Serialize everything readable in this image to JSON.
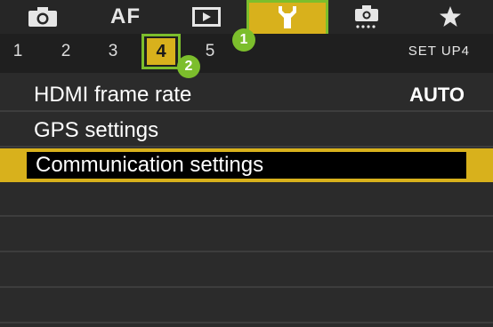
{
  "tabs": [
    {
      "id": "shooting",
      "icon": "camera-icon"
    },
    {
      "id": "af",
      "label": "AF"
    },
    {
      "id": "playback",
      "icon": "playback-icon"
    },
    {
      "id": "setup",
      "icon": "wrench-icon",
      "active": true
    },
    {
      "id": "custom",
      "icon": "custom-functions-icon"
    },
    {
      "id": "mymenu",
      "icon": "star-icon"
    }
  ],
  "pages": {
    "numbers": [
      "1",
      "2",
      "3",
      "4",
      "5"
    ],
    "active": "4",
    "title": "SET UP4"
  },
  "callouts": {
    "tab_badge": "1",
    "page_badge": "2"
  },
  "menu": {
    "items": [
      {
        "label": "HDMI frame rate",
        "value": "AUTO"
      },
      {
        "label": "GPS settings",
        "value": ""
      },
      {
        "label": "Communication settings",
        "value": "",
        "selected": true
      },
      {
        "label": "",
        "value": ""
      },
      {
        "label": "",
        "value": ""
      },
      {
        "label": "",
        "value": ""
      },
      {
        "label": "",
        "value": ""
      }
    ]
  },
  "colors": {
    "accent": "#d8b11c",
    "callout": "#7cbe2c",
    "background": "#2b2b2b"
  }
}
